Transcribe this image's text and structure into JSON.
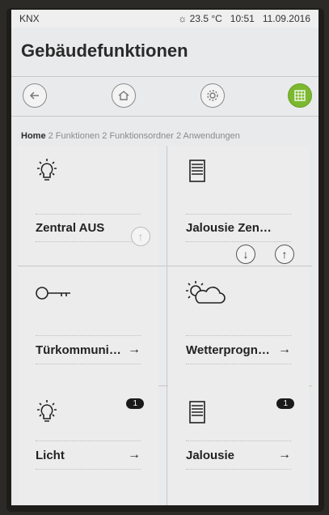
{
  "statusbar": {
    "left": "KNX",
    "weather": "23.5 °C",
    "time": "10:51",
    "date": "11.09.2016"
  },
  "page_title": "Gebäudefunktionen",
  "breadcrumb": {
    "home": "Home",
    "path": " 2 Funktionen 2 Funktionsordner 2 Anwendungen"
  },
  "tiles": [
    {
      "label": "Zentral AUS",
      "icon": "bulb-icon"
    },
    {
      "label": "Jalousie Zen…",
      "icon": "blind-icon"
    },
    {
      "label": "Türkommuni…",
      "icon": "key-icon"
    },
    {
      "label": "Wetterprogn…",
      "icon": "weather-icon"
    },
    {
      "label": "Licht",
      "icon": "bulb-icon",
      "badge": "1"
    },
    {
      "label": "Jalousie",
      "icon": "blind-icon",
      "badge": "1"
    }
  ],
  "arrows": {
    "right": "→",
    "up": "↑",
    "down": "↓"
  },
  "colors": {
    "active": "#7cb82f"
  }
}
